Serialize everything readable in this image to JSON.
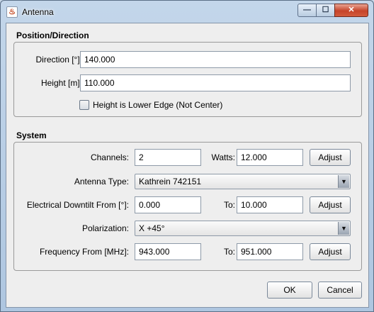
{
  "window": {
    "title": "Antenna",
    "icon": "java-cup-icon",
    "controls": {
      "minimize": "—",
      "maximize": "☐",
      "close": "✕"
    }
  },
  "position": {
    "title": "Position/Direction",
    "direction_label": "Direction [°]:",
    "direction_value": "140.000",
    "height_label": "Height [m]:",
    "height_value": "110.000",
    "lower_edge_label": "Height is Lower Edge (Not Center)",
    "lower_edge_checked": false
  },
  "system": {
    "title": "System",
    "channels_label": "Channels:",
    "channels_value": "2",
    "watts_label": "Watts:",
    "watts_value": "12.000",
    "adjust_label": "Adjust",
    "antenna_type_label": "Antenna Type:",
    "antenna_type_value": "Kathrein 742151",
    "downtilt_from_label": "Electrical Downtilt From [°]:",
    "downtilt_from_value": "0.000",
    "to_label": "To:",
    "downtilt_to_value": "10.000",
    "polarization_label": "Polarization:",
    "polarization_value": "X +45°",
    "frequency_from_label": "Frequency From [MHz]:",
    "frequency_from_value": "943.000",
    "frequency_to_value": "951.000"
  },
  "footer": {
    "ok_label": "OK",
    "cancel_label": "Cancel"
  }
}
